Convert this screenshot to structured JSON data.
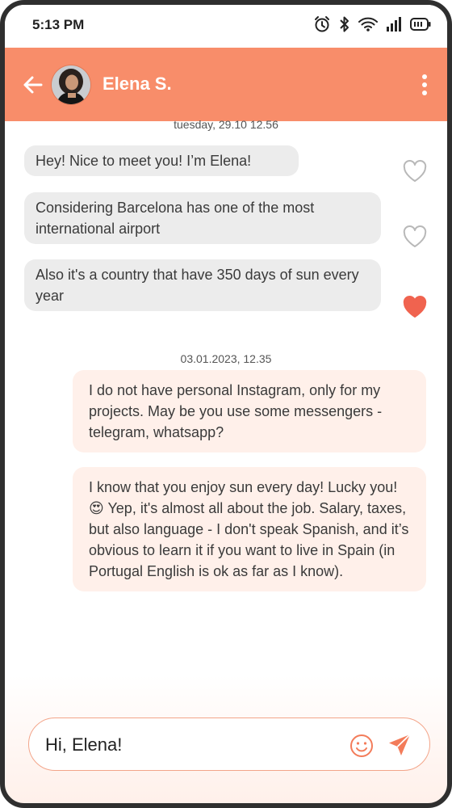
{
  "status_bar": {
    "time": "5:13 PM",
    "icons": [
      "alarm-icon",
      "bluetooth-icon",
      "wifi-icon",
      "signal-icon",
      "battery-icon"
    ]
  },
  "header": {
    "contact_name": "Elena S.",
    "back_icon": "arrow-left-icon",
    "menu_icon": "more-vertical-icon"
  },
  "conversation": {
    "groups": [
      {
        "date": "tuesday, 29.10  12.56",
        "messages": [
          {
            "direction": "incoming",
            "text": "Hey! Nice to meet you! I’m Elena!",
            "liked": false
          },
          {
            "direction": "incoming",
            "text": "Considering Barcelona has one of the most international airport",
            "liked": false
          },
          {
            "direction": "incoming",
            "text": "Also it's a country that have 350 days of sun every year",
            "liked": true
          }
        ]
      },
      {
        "date": "03.01.2023, 12.35",
        "messages": [
          {
            "direction": "outgoing",
            "text": "I do not have personal Instagram, only for my projects. May be you use some messengers - telegram, whatsapp?"
          },
          {
            "direction": "outgoing",
            "text": "I know that you enjoy sun every day! Lucky you! 😍 Yep, it's almost all about the job. Salary, taxes, but also language - I don't speak Spanish, and it’s obvious to learn it if you want to live in Spain (in Portugal English is ok as far as I know)."
          }
        ]
      }
    ]
  },
  "composer": {
    "value": "Hi, Elena!",
    "emoji_icon": "smiley-icon",
    "send_icon": "send-icon"
  },
  "colors": {
    "accent": "#f88d6a",
    "heart_liked": "#f0634f",
    "incoming_bubble": "#ececec",
    "outgoing_bubble": "#fff0ea"
  }
}
